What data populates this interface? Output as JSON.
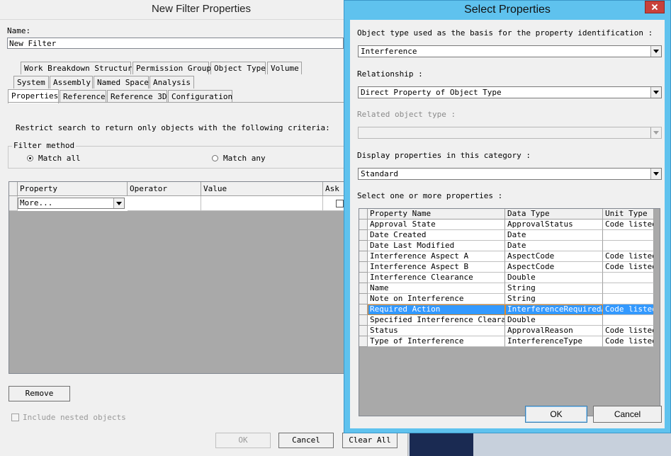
{
  "left_dialog": {
    "title": "New Filter Properties",
    "name_label": "Name:",
    "name_value": "New Filter",
    "tabs_row1": [
      "Work Breakdown Structure",
      "Permission Group",
      "Object Type",
      "Volume"
    ],
    "tabs_row2": [
      "System",
      "Assembly",
      "Named Space",
      "Analysis"
    ],
    "tabs_row3": [
      "Properties",
      "Reference",
      "Reference 3D",
      "Configuration"
    ],
    "restrict_text": "Restrict search to return only objects with the following criteria:",
    "filter_method_label": "Filter method",
    "match_all_label": "Match all",
    "match_any_label": "Match any",
    "columns": [
      "Property",
      "Operator",
      "Value",
      "Ask"
    ],
    "property_combo_value": "More...",
    "remove_label": "Remove",
    "include_nested_label": "Include nested objects",
    "ok_label": "OK",
    "cancel_label": "Cancel",
    "clear_all_label": "Clear All"
  },
  "right_dialog": {
    "title": "Select Properties",
    "object_type_label": "Object type used as the basis for the property identification :",
    "object_type_value": "Interference",
    "relationship_label": "Relationship :",
    "relationship_value": "Direct Property of Object Type",
    "related_object_type_label": "Related object type :",
    "related_object_type_value": "",
    "display_category_label": "Display properties in this category :",
    "display_category_value": "Standard",
    "select_label": "Select one or more properties :",
    "grid_columns": [
      "Property Name",
      "Data Type",
      "Unit Type"
    ],
    "rows": [
      {
        "name": "Approval State",
        "type": "ApprovalStatus",
        "unit": "Code listed"
      },
      {
        "name": "Date Created",
        "type": "Date",
        "unit": ""
      },
      {
        "name": "Date Last Modified",
        "type": "Date",
        "unit": ""
      },
      {
        "name": "Interference Aspect A",
        "type": "AspectCode",
        "unit": "Code listed"
      },
      {
        "name": "Interference Aspect B",
        "type": "AspectCode",
        "unit": "Code listed"
      },
      {
        "name": "Interference Clearance",
        "type": "Double",
        "unit": ""
      },
      {
        "name": "Name",
        "type": "String",
        "unit": ""
      },
      {
        "name": "Note on Interference",
        "type": "String",
        "unit": ""
      },
      {
        "name": "Required Action",
        "type": "InterferenceRequiredAc",
        "unit": "Code listed"
      },
      {
        "name": "Specified Interference Clearance",
        "type": "Double",
        "unit": ""
      },
      {
        "name": "Status",
        "type": "ApprovalReason",
        "unit": "Code listed"
      },
      {
        "name": "Type of Interference",
        "type": "InterferenceType",
        "unit": "Code listed"
      }
    ],
    "selected_row": "Required Action",
    "ok_label": "OK",
    "cancel_label": "Cancel"
  },
  "colors": {
    "dialog_bg": "#f0f0f0",
    "active_frame": "#5fc2ee",
    "selection": "#3399ff",
    "close_button": "#c8413a"
  }
}
